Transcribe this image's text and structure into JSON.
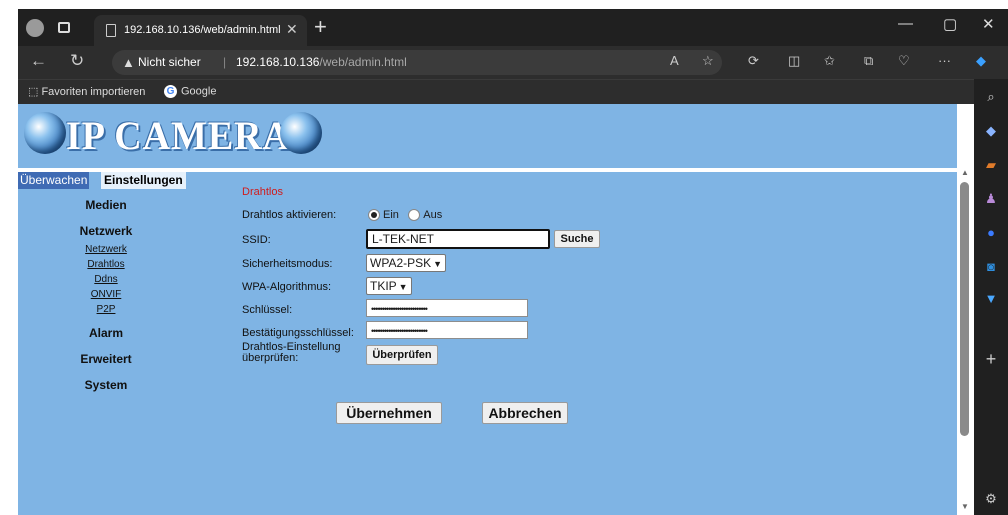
{
  "browser": {
    "tab_title": "192.168.10.136/web/admin.html",
    "secure_label": "Nicht sicher",
    "url_host": "192.168.10.136",
    "url_path": "/web/admin.html",
    "favorites": [
      {
        "label": "Favoriten importieren"
      },
      {
        "label": "Google"
      }
    ]
  },
  "header": {
    "logo": "IP CAMERA"
  },
  "topnav": {
    "monitor": "Überwachen",
    "settings": "Einstellungen"
  },
  "leftnav": {
    "media": "Medien",
    "network": "Netzwerk",
    "network_items": [
      "Netzwerk",
      "Drahtlos",
      "Ddns",
      "ONVIF",
      "P2P"
    ],
    "alarm": "Alarm",
    "advanced": "Erweitert",
    "system": "System"
  },
  "form": {
    "section_title": "Drahtlos",
    "enable_label": "Drahtlos aktivieren:",
    "enable_on": "Ein",
    "enable_off": "Aus",
    "ssid_label": "SSID:",
    "ssid_value": "L-TEK-NET",
    "search_button": "Suche",
    "security_label": "Sicherheitsmodus:",
    "security_value": "WPA2-PSK",
    "wpa_label": "WPA-Algorithmus:",
    "wpa_value": "TKIP",
    "key_label": "Schlüssel:",
    "key_value": "••••••••••••••••••••••••••",
    "confirm_label": "Bestätigungsschlüssel:",
    "confirm_value": "••••••••••••••••••••••••••",
    "check_label_1": "Drahtlos-Einstellung",
    "check_label_2": "überprüfen:",
    "check_button": "Überprüfen",
    "apply_button": "Übernehmen",
    "cancel_button": "Abbrechen"
  }
}
